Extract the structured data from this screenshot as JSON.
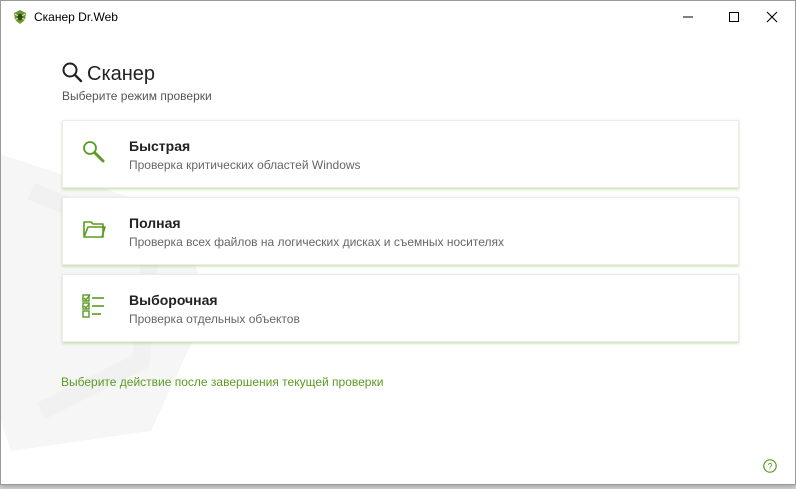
{
  "window": {
    "title": "Сканер Dr.Web"
  },
  "header": {
    "title": "Сканер",
    "subtitle": "Выберите режим проверки"
  },
  "scan_modes": [
    {
      "title": "Быстрая",
      "description": "Проверка критических областей Windows",
      "icon": "quick-scan-magnifier-icon"
    },
    {
      "title": "Полная",
      "description": "Проверка всех файлов на логических дисках и съемных носителях",
      "icon": "folder-icon"
    },
    {
      "title": "Выборочная",
      "description": "Проверка отдельных объектов",
      "icon": "checklist-icon"
    }
  ],
  "footer": {
    "action_link": "Выберите действие после завершения текущей проверки",
    "help_icon": "help-icon"
  },
  "colors": {
    "accent": "#5a9b22",
    "card_shadow": "#a8d878",
    "text_primary": "#222222",
    "text_secondary": "#666666"
  }
}
